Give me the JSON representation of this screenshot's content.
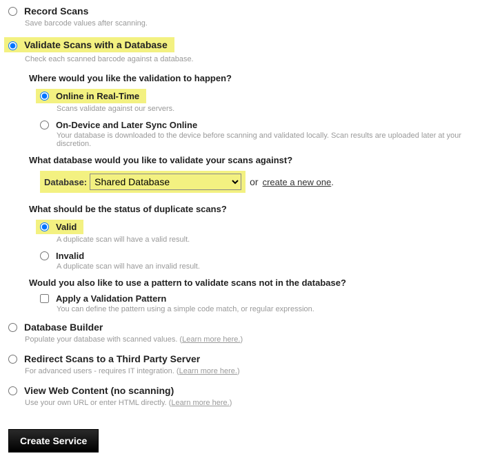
{
  "options": {
    "record": {
      "label": "Record Scans",
      "desc": "Save barcode values after scanning."
    },
    "validate": {
      "label": "Validate Scans with a Database",
      "desc": "Check each scanned barcode against a database."
    },
    "builder": {
      "label": "Database Builder",
      "desc_prefix": "Populate your database with scanned values. (",
      "learn": "Learn more here.",
      "desc_suffix": ")"
    },
    "redirect": {
      "label": "Redirect Scans to a Third Party Server",
      "desc_prefix": "For advanced users - requires IT integration. (",
      "learn": "Learn more here.",
      "desc_suffix": ")"
    },
    "webcontent": {
      "label": "View Web Content (no scanning)",
      "desc_prefix": "Use your own URL or enter HTML directly. (",
      "learn": "Learn more here.",
      "desc_suffix": ")"
    }
  },
  "validate_section": {
    "q_where": "Where would you like the validation to happen?",
    "online": {
      "label": "Online in Real-Time",
      "desc": "Scans validate against our servers."
    },
    "ondevice": {
      "label": "On-Device and Later Sync Online",
      "desc": "Your database is downloaded to the device before scanning and validated locally. Scan results are uploaded later at your discretion."
    },
    "q_database": "What database would you like to validate your scans against?",
    "db_label": "Database:",
    "db_selected": "Shared Database",
    "db_or": "or",
    "db_create": "create a new one",
    "db_period": ".",
    "q_duplicate": "What should be the status of duplicate scans?",
    "valid": {
      "label": "Valid",
      "desc": "A duplicate scan will have a valid result."
    },
    "invalid": {
      "label": "Invalid",
      "desc": "A duplicate scan will have an invalid result."
    },
    "q_pattern": "Would you also like to use a pattern to validate scans not in the database?",
    "pattern": {
      "label": "Apply a Validation Pattern",
      "desc": "You can define the pattern using a simple code match, or regular expression."
    }
  },
  "create_button": "Create Service"
}
